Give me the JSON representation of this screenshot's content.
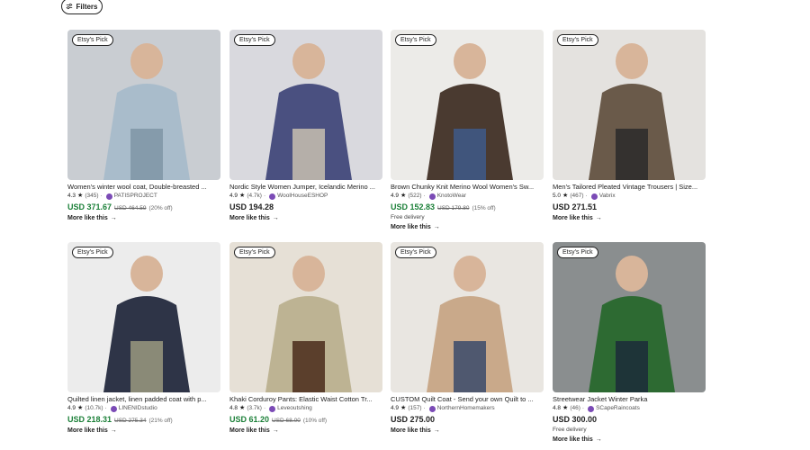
{
  "filters": {
    "label": "Filters",
    "icon": "sliders-icon"
  },
  "badge_label": "Etsy's Pick",
  "more_label": "More like this",
  "cards": [
    {
      "title": "Women's winter wool coat, Double-breasted ...",
      "rating": "4.3",
      "reviews": "(345)",
      "shop": "PATISPROJECT",
      "price": "USD 371.67",
      "orig": "USD 464.59",
      "off": "(20% off)",
      "delivery": "",
      "sale": true,
      "colors": {
        "bg": "#c9cdd2",
        "main": "#a9bccb",
        "accent": "#7f95a6"
      }
    },
    {
      "title": "Nordic Style Women Jumper, Icelandic Merino ...",
      "rating": "4.9",
      "reviews": "(4.7k)",
      "shop": "WoolHouseESHOP",
      "price": "USD 194.28",
      "orig": "",
      "off": "",
      "delivery": "",
      "sale": false,
      "colors": {
        "bg": "#d9d9de",
        "main": "#4a5080",
        "accent": "#c8c0b0"
      }
    },
    {
      "title": "Brown Chunky Knit Merino Wool Women's Sw...",
      "rating": "4.9",
      "reviews": "(522)",
      "shop": "KnotoWear",
      "price": "USD 152.83",
      "orig": "USD 179.80",
      "off": "(15% off)",
      "delivery": "Free delivery",
      "sale": true,
      "colors": {
        "bg": "#ecebe8",
        "main": "#4a3a30",
        "accent": "#3e5a8a"
      }
    },
    {
      "title": "Men's Tailored Pleated Vintage Trousers | Size...",
      "rating": "5.0",
      "reviews": "(467)",
      "shop": "Vabrix",
      "price": "USD 271.51",
      "orig": "",
      "off": "",
      "delivery": "",
      "sale": false,
      "colors": {
        "bg": "#e4e2df",
        "main": "#6a5a4a",
        "accent": "#2a2a2a"
      }
    },
    {
      "title": "Quilted linen jacket, linen padded coat with p...",
      "rating": "4.9",
      "reviews": "(10.7k)",
      "shop": "LINENIDstudio",
      "price": "USD 218.31",
      "orig": "USD 275.34",
      "off": "(21% off)",
      "delivery": "",
      "sale": true,
      "colors": {
        "bg": "#ececec",
        "main": "#2e3447",
        "accent": "#9a9a80"
      }
    },
    {
      "title": "Khaki Corduroy Pants: Elastic Waist Cotton Tr...",
      "rating": "4.8",
      "reviews": "(3.7k)",
      "shop": "Leveoutshing",
      "price": "USD 61.20",
      "orig": "USD 68.00",
      "off": "(10% off)",
      "delivery": "",
      "sale": true,
      "colors": {
        "bg": "#e6e0d6",
        "main": "#bdb393",
        "accent": "#4a2a1a"
      }
    },
    {
      "title": "CUSTOM Quilt Coat - Send your own Quilt to ...",
      "rating": "4.9",
      "reviews": "(157)",
      "shop": "NorthernHomemakers",
      "price": "USD 275.00",
      "orig": "",
      "off": "",
      "delivery": "",
      "sale": false,
      "colors": {
        "bg": "#e9e6e1",
        "main": "#c9a98a",
        "accent": "#3a4a6a"
      }
    },
    {
      "title": "Streetwear Jacket Winter Parka",
      "rating": "4.8",
      "reviews": "(46)",
      "shop": "SCapeRaincoats",
      "price": "USD 300.00",
      "orig": "",
      "off": "",
      "delivery": "Free delivery",
      "sale": false,
      "colors": {
        "bg": "#8a8e8f",
        "main": "#2d6a32",
        "accent": "#1c2a3a"
      }
    }
  ]
}
